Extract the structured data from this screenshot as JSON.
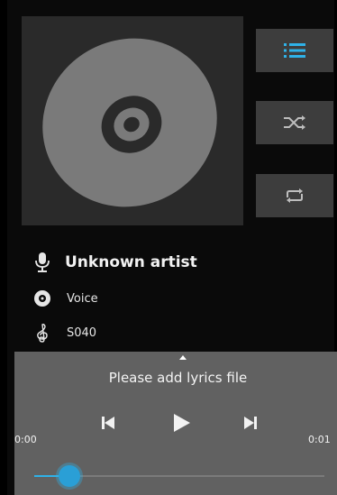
{
  "track": {
    "artist": "Unknown artist",
    "album": "Voice",
    "title": "S040"
  },
  "lyrics": {
    "message": "Please add lyrics file"
  },
  "playback": {
    "elapsed": "0:00",
    "duration": "0:01",
    "progress_fraction": 0.12
  },
  "icons": {
    "playlist": "playlist-icon",
    "shuffle": "shuffle-icon",
    "repeat": "repeat-icon",
    "artist": "microphone-icon",
    "album": "disc-icon",
    "title": "treble-clef-icon",
    "prev": "skip-previous-icon",
    "play": "play-icon",
    "next": "skip-next-icon"
  },
  "colors": {
    "accent": "#2fb2e8",
    "panel": "#616161",
    "button": "#3d3d3d"
  }
}
